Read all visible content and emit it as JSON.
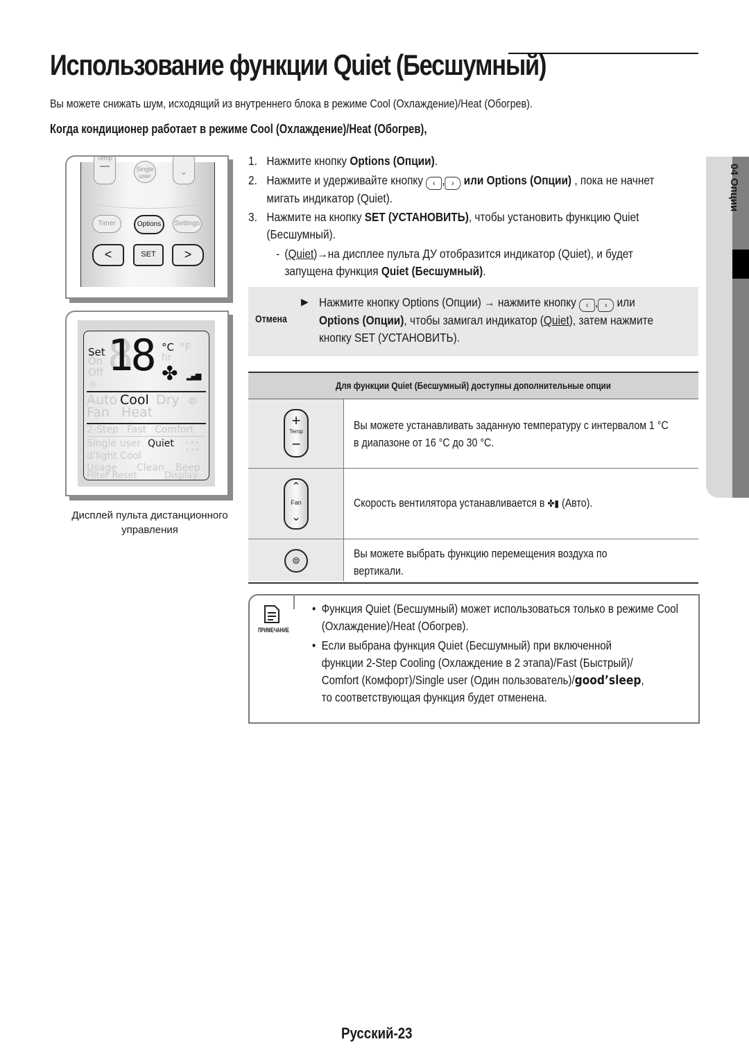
{
  "header": {
    "title": "Использование функции Quiet (Бесшумный)",
    "intro": "Вы можете снижать шум, исходящий из внутреннего блока в режиме Cool (Охлаждение)/Heat (Обогрев).",
    "subheading": "Когда кондиционер работает в режиме Cool (Охлаждение)/Heat (Обогрев),"
  },
  "remote": {
    "buttons": {
      "temp": "Temp",
      "single_user": "Single user",
      "timer": "Timer",
      "options": "Options",
      "settings": "Settings",
      "left": "<",
      "set": "SET",
      "right": ">"
    }
  },
  "display": {
    "set": "Set",
    "on": "On",
    "off": "Off",
    "temperature": "18",
    "unit_c": "°C",
    "unit_f": "°F",
    "hr": "hr",
    "auto": "Auto",
    "cool": "Cool",
    "dry": "Dry",
    "fan": "Fan",
    "heat": "Heat",
    "two_step": "2-Step",
    "fast": "Fast",
    "comfort": "Comfort",
    "single_user": "Single user",
    "quiet": "Quiet",
    "dlight": "d'light Cool",
    "usage": "Usage",
    "clean": "Clean",
    "beep": "Beep",
    "filter_reset": "Filter Reset",
    "display_label": "Display",
    "caption": "Дисплей пульта дистанционного управления"
  },
  "steps": [
    {
      "num": "1.",
      "pre": "Нажмите кнопку ",
      "bold": "Options (Опции)",
      "post": "."
    },
    {
      "num": "2.",
      "pre": "Нажмите и удерживайте кнопку ",
      "sep": ",",
      "bold": "или Options (Опции)",
      "post": " , пока не начнет",
      "line2": "мигать индикатор (Quiet)."
    },
    {
      "num": "3.",
      "pre": "Нажмите на кнопку ",
      "bold": "SET (УСТАНОВИТЬ)",
      "post": ", чтобы установить функцию Quiet",
      "line2": "(Бесшумный)."
    },
    {
      "num": "-",
      "under": "Quiet",
      "pre": "(",
      "post": ")→на дисплее пульта ДУ отобразится индикатор (Quiet), и будет",
      "line2_pre": "запущена функция ",
      "line2_bold": "Quiet (Бесшумный)",
      "line2_post": "."
    }
  ],
  "cancel": {
    "label": "Отмена",
    "line1_pre": "Нажмите кнопку Options (Опции) → нажмите кнопку ",
    "line1_sep": ",",
    "line1_post": " или",
    "line2_bold": "Options (Опции)",
    "line2_pre": ", чтобы замигал индикатор (",
    "line2_under": "Quiet",
    "line2_post": "), затем нажмите",
    "line3": "кнопку SET (УСТАНОВИТЬ)."
  },
  "options_table": {
    "header": "Для функции Quiet (Бесшумный) доступны дополнительные опции",
    "rows": [
      {
        "icon": "temp-button-icon",
        "icon_label": "Temp",
        "line1": "Вы можете устанавливать заданную температуру с интервалом 1 °C",
        "line2": "в диапазоне от 16 °C до 30 °C."
      },
      {
        "icon": "fan-button-icon",
        "icon_label": "Fan",
        "line1_pre": "Скорость вентилятора устанавливается в ",
        "line1_post": " (Авто)."
      },
      {
        "icon": "air-swing-button-icon",
        "line1": "Вы можете выбрать функцию перемещения воздуха по",
        "line2": "вертикали."
      }
    ]
  },
  "note": {
    "label": "ПРИМЕЧАНИЕ",
    "items": [
      {
        "line1": "Функция Quiet (Бесшумный) может использоваться только в режиме Cool",
        "line2": "(Охлаждение)/Heat (Обогрев)."
      },
      {
        "line1": "Если выбрана функция Quiet (Бесшумный) при включенной",
        "line2": "функции 2-Step Cooling (Охлаждение в 2 этапа)/Fast (Быстрый)/",
        "line3_pre": "Comfort (Комфорт)/Single user (Один пользователь)/",
        "line3_brand": "good’sleep",
        "line3_post": ",",
        "line4": "то соответствующая функция будет отменена."
      }
    ]
  },
  "side_tab": {
    "chapter": "04  Опции"
  },
  "footer": {
    "page": "Русский-23"
  }
}
